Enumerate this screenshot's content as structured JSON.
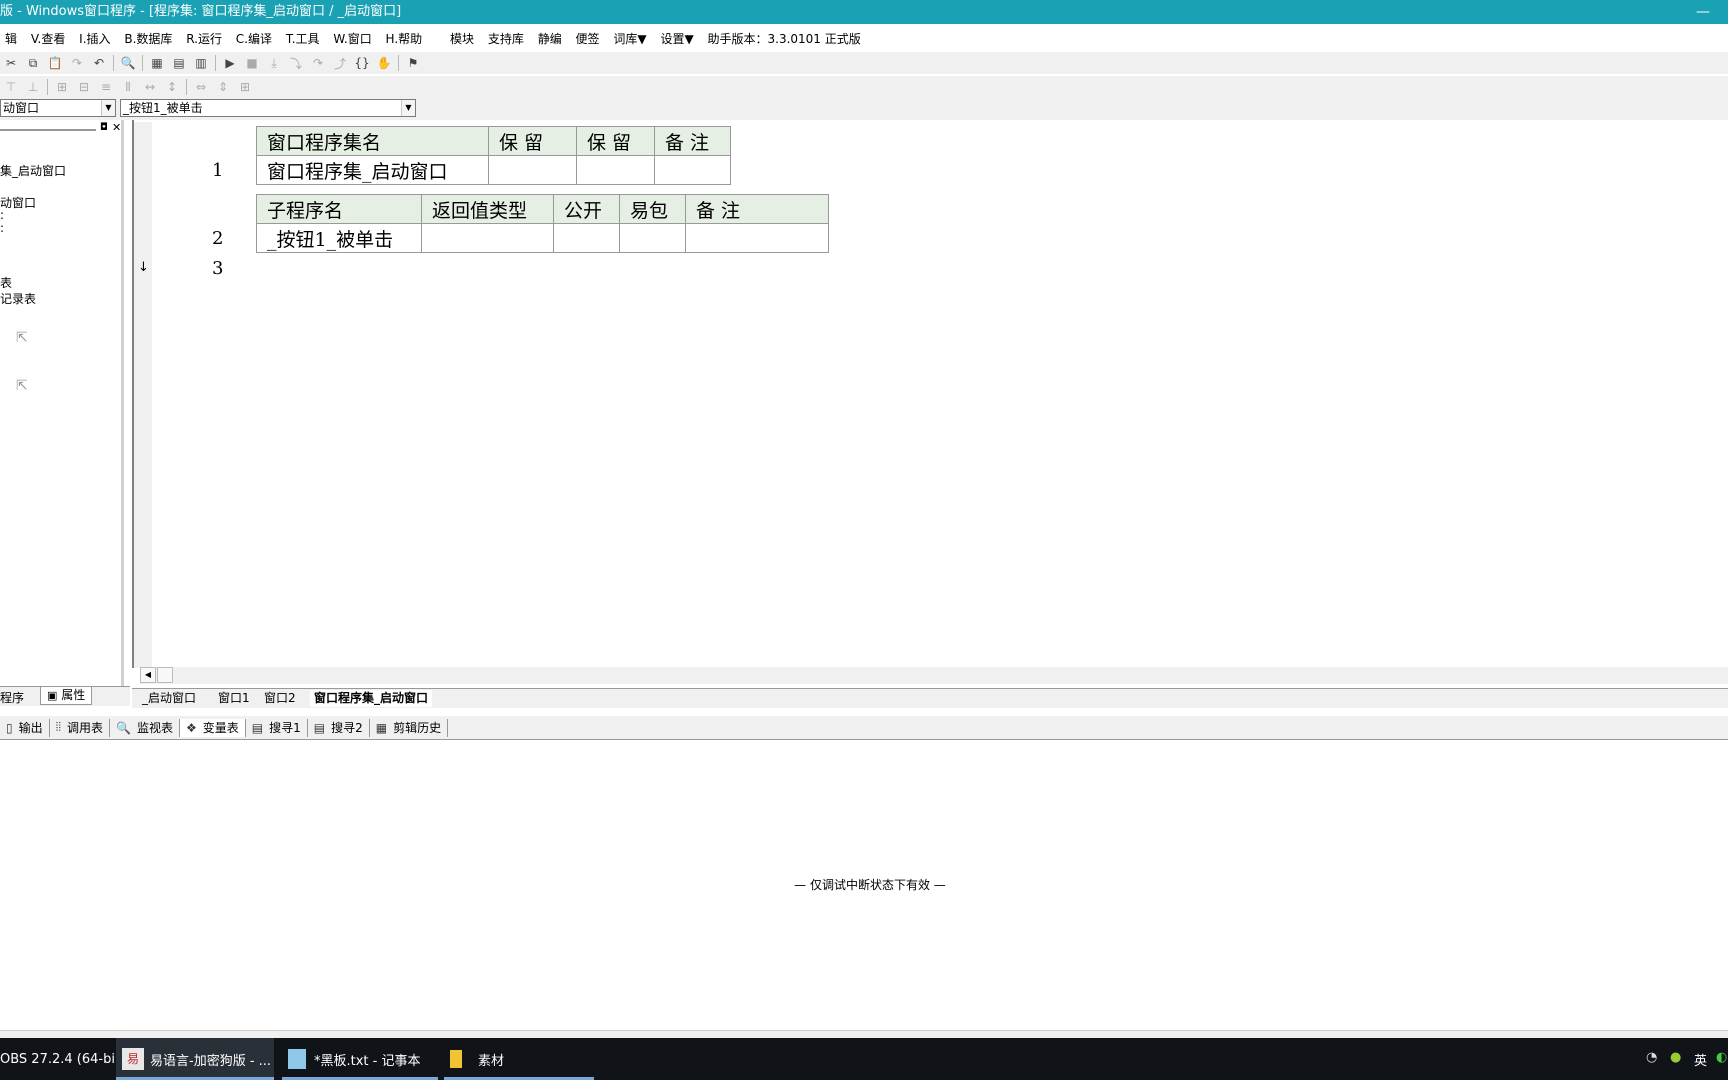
{
  "window": {
    "title": "版 - Windows窗口程序 - [程序集: 窗口程序集_启动窗口 / _启动窗口]",
    "minimize": "—"
  },
  "menu": [
    "辑",
    "V.查看",
    "I.插入",
    "B.数据库",
    "R.运行",
    "C.编译",
    "T.工具",
    "W.窗口",
    "H.帮助",
    "模块",
    "支持库",
    "静编",
    "便签",
    "词库▼",
    "设置▼",
    "助手版本：3.3.0101 正式版"
  ],
  "combos": {
    "left": "动窗口",
    "right": "_按钮1_被单击"
  },
  "tree": [
    "集_启动窗口",
    "动窗口",
    ":",
    ":",
    "表",
    "记录表"
  ],
  "left_tabs": {
    "program": "程序",
    "properties": "属性"
  },
  "editor": {
    "line_numbers": [
      "1",
      "2",
      "3"
    ],
    "assembly_table": {
      "headers": [
        "窗口程序集名",
        "保 留",
        "保 留",
        "备 注"
      ],
      "row": [
        "窗口程序集_启动窗口",
        "",
        "",
        ""
      ]
    },
    "sub_table": {
      "headers": [
        "子程序名",
        "返回值类型",
        "公开",
        "易包",
        "备 注"
      ],
      "row": [
        "_按钮1_被单击",
        "",
        "",
        "",
        ""
      ]
    },
    "arrow": "↓"
  },
  "file_tabs": [
    "_启动窗口",
    "窗口1",
    "窗口2",
    "窗口程序集_启动窗口"
  ],
  "bottom_tabs": [
    "输出",
    "调用表",
    "监视表",
    "变量表",
    "搜寻1",
    "搜寻2",
    "剪辑历史"
  ],
  "debug_note": "— 仅调试中断状态下有效 —",
  "taskbar": {
    "items": [
      "OBS 27.2.4 (64-bi...",
      "易语言-加密狗版 - ...",
      "*黑板.txt - 记事本",
      "素材"
    ],
    "ime": "英"
  }
}
